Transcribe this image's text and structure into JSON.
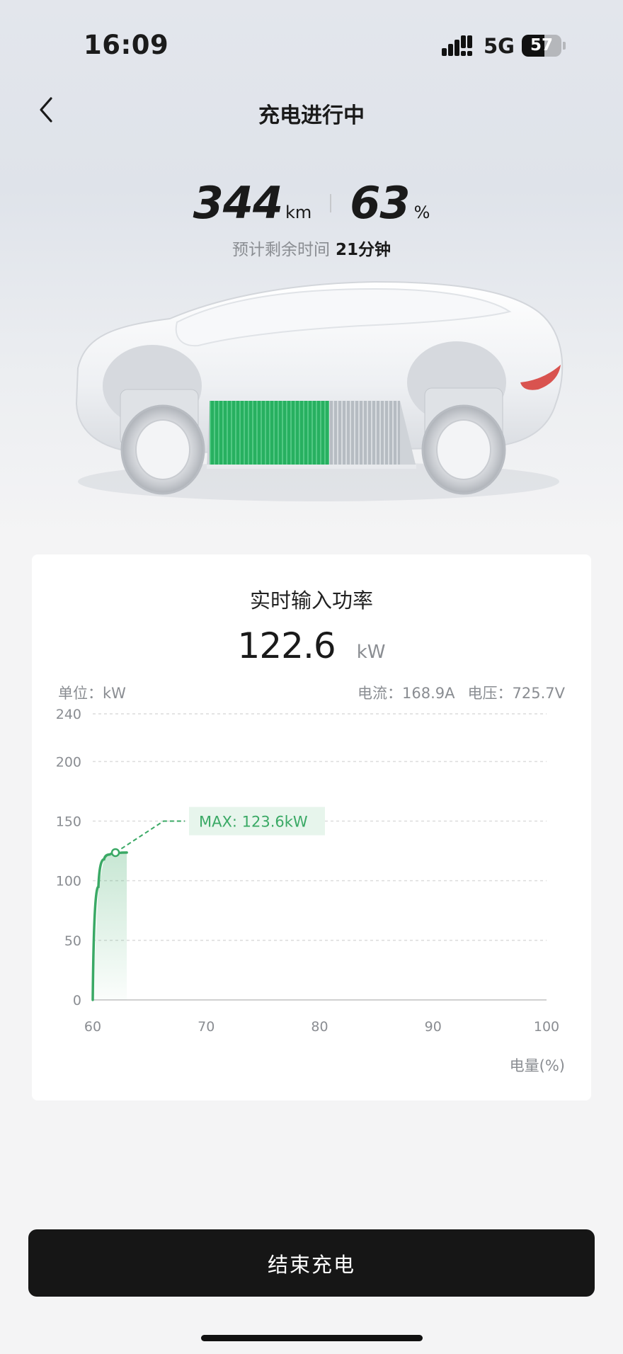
{
  "status_bar": {
    "time": "16:09",
    "network": "5G",
    "battery_level": "57",
    "battery_fraction": 0.57
  },
  "header": {
    "title": "充电进行中",
    "back_icon": "chevron-left-icon"
  },
  "summary": {
    "range_value": "344",
    "range_unit": "km",
    "soc_value": "63",
    "soc_unit": "%",
    "remaining_label": "预计剩余时间",
    "remaining_value": "21分钟",
    "battery_fill_fraction": 0.63,
    "battery_color": "#3cbf6e"
  },
  "card": {
    "title": "实时输入功率",
    "power_value": "122.6",
    "power_unit": "kW",
    "unit_text": "单位：kW",
    "current_text": "电流：168.9A",
    "voltage_text": "电压：725.7V"
  },
  "chart_data": {
    "type": "line",
    "x": [
      60,
      60.5,
      61,
      61.5,
      62,
      62.5,
      63
    ],
    "series": [
      {
        "values": [
          0,
          95,
          118,
          122,
          123,
          123.5,
          123.6
        ]
      }
    ],
    "x_ticks": [
      "60",
      "70",
      "80",
      "90",
      "100"
    ],
    "y_ticks": [
      "240",
      "200",
      "150",
      "100",
      "50",
      "0"
    ],
    "xlabel": "电量(%)",
    "xlim": [
      60,
      100
    ],
    "ylim": [
      0,
      240
    ],
    "max_point": {
      "x": 62,
      "y": 123.6
    },
    "max_label": "MAX: 123.6kW",
    "grid": true,
    "line_color": "#3aa965"
  },
  "actions": {
    "end_charge_label": "结束充电"
  }
}
